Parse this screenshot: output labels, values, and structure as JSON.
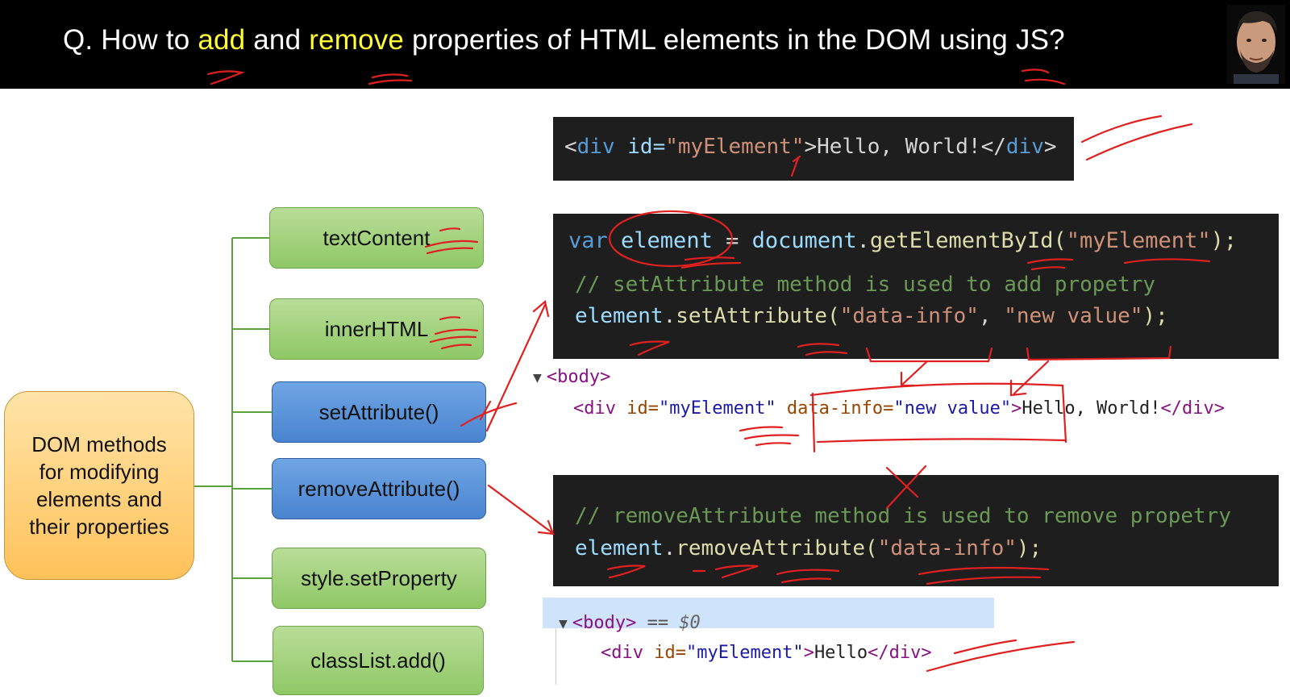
{
  "header": {
    "title_prefix": "Q. How to ",
    "title_add": "add",
    "title_and": " and ",
    "title_remove": "remove",
    "title_suffix": " properties of HTML elements in the DOM using JS?"
  },
  "mindmap": {
    "root_label": "DOM methods for modifying elements and their properties",
    "nodes": [
      {
        "label": "textContent",
        "style": "green"
      },
      {
        "label": "innerHTML",
        "style": "green"
      },
      {
        "label": "setAttribute()",
        "style": "blue"
      },
      {
        "label": "removeAttribute()",
        "style": "blue"
      },
      {
        "label": "style.setProperty",
        "style": "green"
      },
      {
        "label": "classList.add()",
        "style": "green"
      }
    ]
  },
  "code_html": {
    "open_lt": "<",
    "tag": "div",
    "attr": " id=",
    "val": "\"myElement\"",
    "gt": ">",
    "text": "Hello, World!",
    "close": "</",
    "close_tag": "div",
    "close_gt": ">"
  },
  "code_set": {
    "l1_var": "var",
    "l1_name": " element",
    "l1_eq": " = ",
    "l1_obj": "document",
    "l1_dot": ".",
    "l1_fn": "getElementById",
    "l1_p1": "(",
    "l1_str": "\"myElement\"",
    "l1_p2": ");",
    "l2_comment": "// setAttribute method is used to add propetry",
    "l3_obj": "element",
    "l3_dot": ".",
    "l3_fn": "setAttribute",
    "l3_p1": "(",
    "l3_s1": "\"data-info\"",
    "l3_comma": ", ",
    "l3_s2": "\"new value\"",
    "l3_p2": ");"
  },
  "dom_set": {
    "body_tag": "<body>",
    "lt": "<",
    "tag": "div",
    "attr1": " id=",
    "val1": "\"myElement\"",
    "attr2": " data-info=",
    "val2": "\"new value\"",
    "gt": ">",
    "text": "Hello, World!",
    "close": "</div>"
  },
  "code_remove": {
    "l1_comment": "// removeAttribute method is used to remove propetry",
    "l2_obj": "element",
    "l2_dot": ".",
    "l2_fn": "removeAttribute",
    "l2_p1": "(",
    "l2_s1": "\"data-info\"",
    "l2_p2": ");"
  },
  "dom_remove": {
    "body_tag": "<body>",
    "eq": " == ",
    "sel": "$0",
    "lt": "<",
    "tag": "div",
    "attr1": " id=",
    "val1": "\"myElement\"",
    "gt": ">",
    "text": "Hello",
    "close": "</div>"
  },
  "colors": {
    "highlight": "#ffff33",
    "annotation": "#e02020",
    "node_green": "#a6d47f",
    "node_blue": "#5b94db",
    "root_orange": "#ffd27a"
  }
}
